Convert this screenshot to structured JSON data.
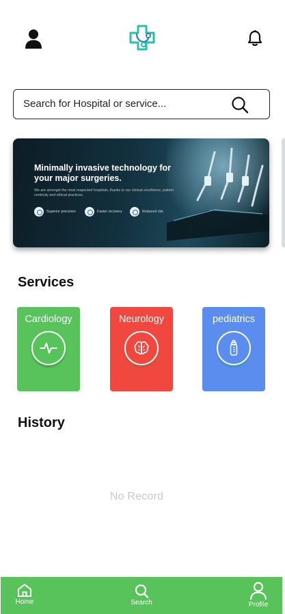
{
  "header": {
    "profile_icon": "user-icon",
    "logo_icon": "medical-cross-stethoscope-logo",
    "notifications_icon": "bell-icon"
  },
  "search": {
    "placeholder": "Search for Hospital or service...",
    "value": "",
    "icon": "search-icon"
  },
  "banner": {
    "title": "Minimally invasive technology for your major surgeries.",
    "subtitle": "We are amongst the most respected hospitals, thanks to our clinical excellence, patient centricity and ethical practices.",
    "features": [
      "Superior precision",
      "Faster recovery",
      "Reduced risk"
    ]
  },
  "services": {
    "title": "Services",
    "items": [
      {
        "label": "Cardiology",
        "icon": "heartbeat-icon",
        "color": "#57c35a"
      },
      {
        "label": "Neurology",
        "icon": "brain-icon",
        "color": "#f0483e"
      },
      {
        "label": "pediatrics",
        "icon": "baby-bottle-icon",
        "color": "#5b8def"
      }
    ]
  },
  "history": {
    "title": "History",
    "empty_text": "No Record"
  },
  "bottom_nav": {
    "items": [
      {
        "label": "Home",
        "icon": "home-icon"
      },
      {
        "label": "Search",
        "icon": "search-icon"
      },
      {
        "label": "Profile",
        "icon": "profile-icon"
      }
    ]
  },
  "colors": {
    "accent_green": "#57c35a",
    "neurology_red": "#f0483e",
    "pediatrics_blue": "#5b8def",
    "logo_teal": "#2bbfa4"
  }
}
